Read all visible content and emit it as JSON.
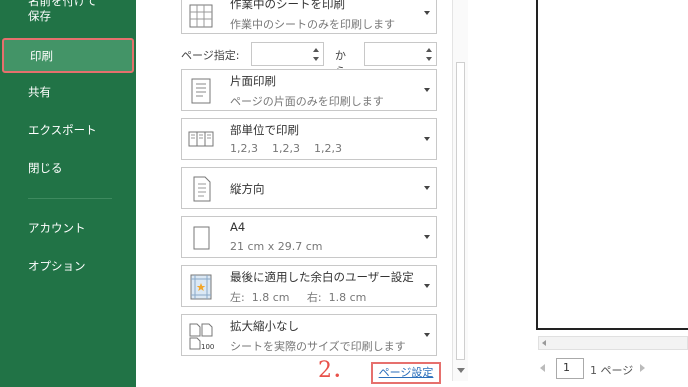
{
  "sidebar": {
    "items": [
      {
        "label": "名前を付けて\n保存"
      },
      {
        "label": "印刷"
      },
      {
        "label": "共有"
      },
      {
        "label": "エクスポート"
      },
      {
        "label": "閉じる"
      },
      {
        "label": "アカウント"
      },
      {
        "label": "オプション"
      }
    ]
  },
  "settings": {
    "print_what": {
      "title": "作業中のシートを印刷",
      "desc": "作業中のシートのみを印刷します"
    },
    "pages": {
      "label": "ページ指定:",
      "from": "",
      "to_label": "から",
      "to": ""
    },
    "sides": {
      "title": "片面印刷",
      "desc": "ページの片面のみを印刷します"
    },
    "collate": {
      "title": "部単位で印刷",
      "desc": "1,2,3    1,2,3    1,2,3"
    },
    "orientation": {
      "title": "縦方向"
    },
    "paper_size": {
      "title": "A4",
      "desc": "21 cm x 29.7 cm"
    },
    "margins": {
      "title": "最後に適用した余白のユーザー設定",
      "desc": "左:  1.8 cm     右:  1.8 cm"
    },
    "scaling": {
      "title": "拡大縮小なし",
      "desc": "シートを実際のサイズで印刷します"
    },
    "step_number": "2．",
    "page_setup_link": "ページ設定"
  },
  "preview": {
    "current_page": "1",
    "total_pages": "1 ページ"
  }
}
